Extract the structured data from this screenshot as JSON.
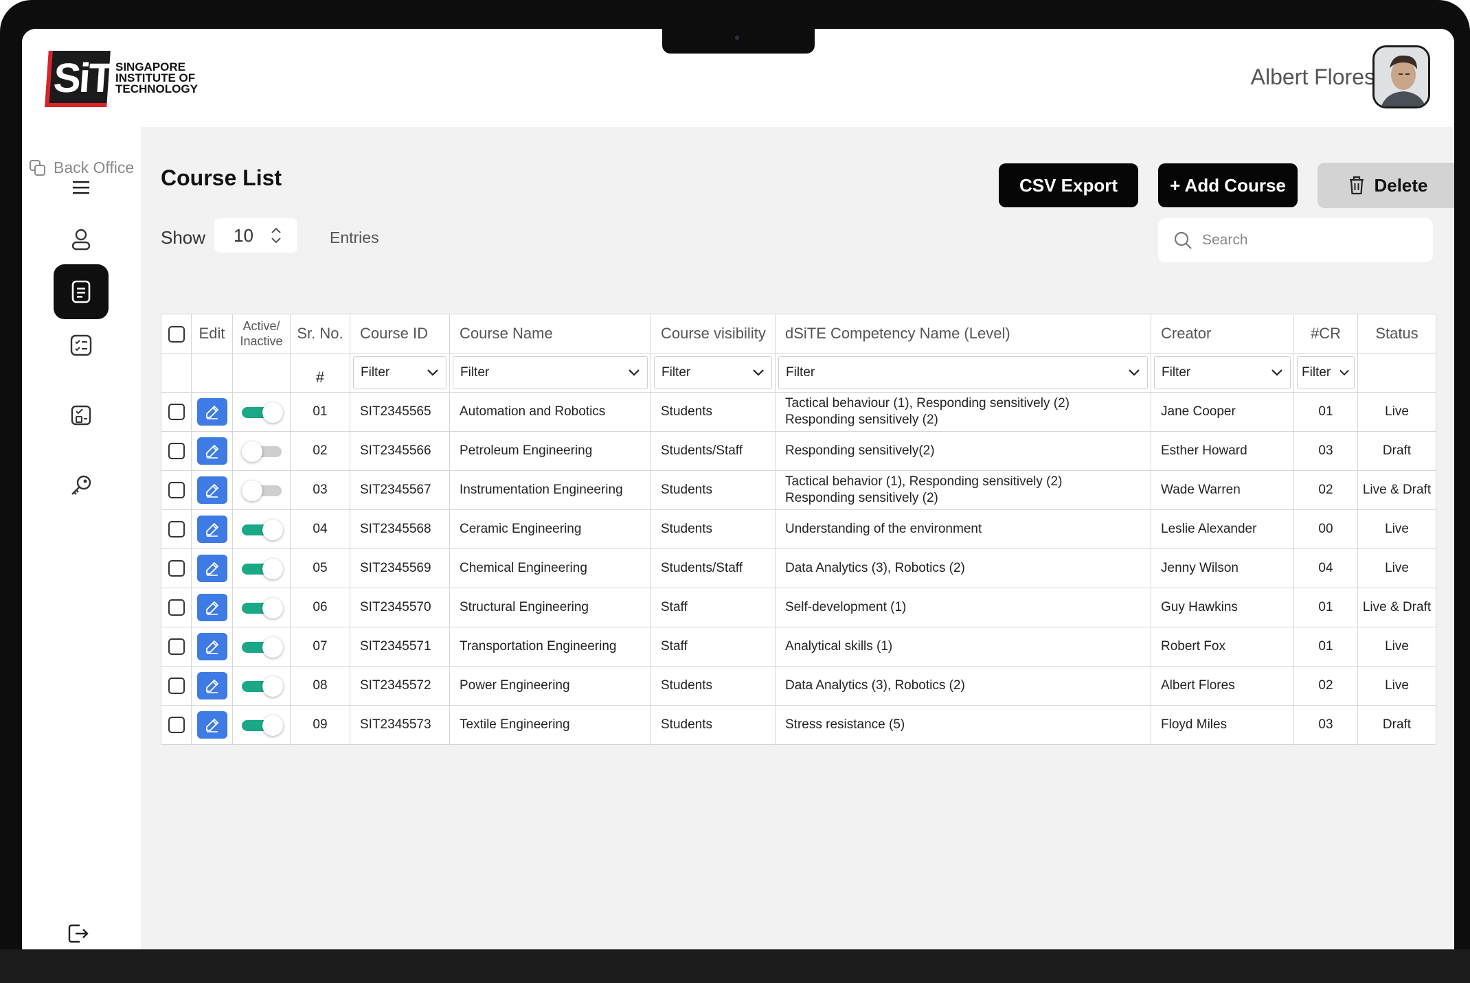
{
  "brand": {
    "logo_mark": "SiT",
    "logo_lines": [
      "SINGAPORE",
      "INSTITUTE OF",
      "TECHNOLOGY"
    ]
  },
  "user": {
    "name": "Albert Flores"
  },
  "sidebar": {
    "back_office_label": "Back Office",
    "items": [
      {
        "icon": "menu-icon"
      },
      {
        "icon": "user-icon"
      },
      {
        "icon": "course-list-icon",
        "active": true
      },
      {
        "icon": "checklist-icon"
      },
      {
        "icon": "assessment-icon"
      },
      {
        "icon": "key-icon"
      }
    ],
    "logout_icon": "logout-icon"
  },
  "page": {
    "title": "Course List",
    "actions": {
      "csv_export": "CSV Export",
      "add_course": "+ Add Course",
      "delete": "Delete"
    },
    "show_label": "Show",
    "entries_value": "10",
    "entries_label": "Entries",
    "search_placeholder": "Search"
  },
  "table": {
    "headers": {
      "edit": "Edit",
      "active_line1": "Active/",
      "active_line2": "Inactive",
      "sr_no": "Sr. No.",
      "course_id": "Course ID",
      "course_name": "Course Name",
      "visibility": "Course visibility",
      "competency": "dSiTE Competency Name (Level)",
      "creator": "Creator",
      "cr": "#CR",
      "status": "Status"
    },
    "filter_row": {
      "hash": "#",
      "filter_label": "Filter"
    },
    "rows": [
      {
        "sr": "01",
        "id": "SIT2345565",
        "name": "Automation and Robotics",
        "visibility": "Students",
        "competency": [
          "Tactical behaviour (1), Responding sensitively (2)",
          "Responding sensitively (2)"
        ],
        "creator": "Jane Cooper",
        "cr": "01",
        "status": "Live",
        "active": true
      },
      {
        "sr": "02",
        "id": "SIT2345566",
        "name": "Petroleum Engineering",
        "visibility": "Students/Staff",
        "competency": [
          "Responding sensitively(2)"
        ],
        "creator": "Esther Howard",
        "cr": "03",
        "status": "Draft",
        "active": false
      },
      {
        "sr": "03",
        "id": "SIT2345567",
        "name": "Instrumentation Engineering",
        "visibility": "Students",
        "competency": [
          "Tactical behavior (1), Responding sensitively (2)",
          "Responding sensitively (2)"
        ],
        "creator": "Wade Warren",
        "cr": "02",
        "status": "Live & Draft",
        "active": false
      },
      {
        "sr": "04",
        "id": "SIT2345568",
        "name": "Ceramic Engineering",
        "visibility": "Students",
        "competency": [
          "Understanding of the environment"
        ],
        "creator": "Leslie Alexander",
        "cr": "00",
        "status": "Live",
        "active": true
      },
      {
        "sr": "05",
        "id": "SIT2345569",
        "name": "Chemical Engineering",
        "visibility": "Students/Staff",
        "competency": [
          "Data Analytics (3), Robotics (2)"
        ],
        "creator": "Jenny Wilson",
        "cr": "04",
        "status": "Live",
        "active": true
      },
      {
        "sr": "06",
        "id": "SIT2345570",
        "name": "Structural Engineering",
        "visibility": "Staff",
        "competency": [
          "Self-development (1)"
        ],
        "creator": "Guy Hawkins",
        "cr": "01",
        "status": "Live & Draft",
        "active": true
      },
      {
        "sr": "07",
        "id": "SIT2345571",
        "name": "Transportation Engineering",
        "visibility": "Staff",
        "competency": [
          "Analytical skills (1)"
        ],
        "creator": "Robert Fox",
        "cr": "01",
        "status": "Live",
        "active": true
      },
      {
        "sr": "08",
        "id": "SIT2345572",
        "name": "Power Engineering",
        "visibility": "Students",
        "competency": [
          "Data Analytics (3), Robotics (2)"
        ],
        "creator": "Albert Flores",
        "cr": "02",
        "status": "Live",
        "active": true
      },
      {
        "sr": "09",
        "id": "SIT2345573",
        "name": "Textile Engineering",
        "visibility": "Students",
        "competency": [
          "Stress resistance (5)"
        ],
        "creator": "Floyd Miles",
        "cr": "03",
        "status": "Draft",
        "active": true
      }
    ]
  },
  "colors": {
    "accent_toggle": "#1aa886",
    "edit_button": "#3e7be4",
    "primary_button": "#050505",
    "delete_button": "#d3d3d3",
    "brand_red": "#d8252b"
  }
}
